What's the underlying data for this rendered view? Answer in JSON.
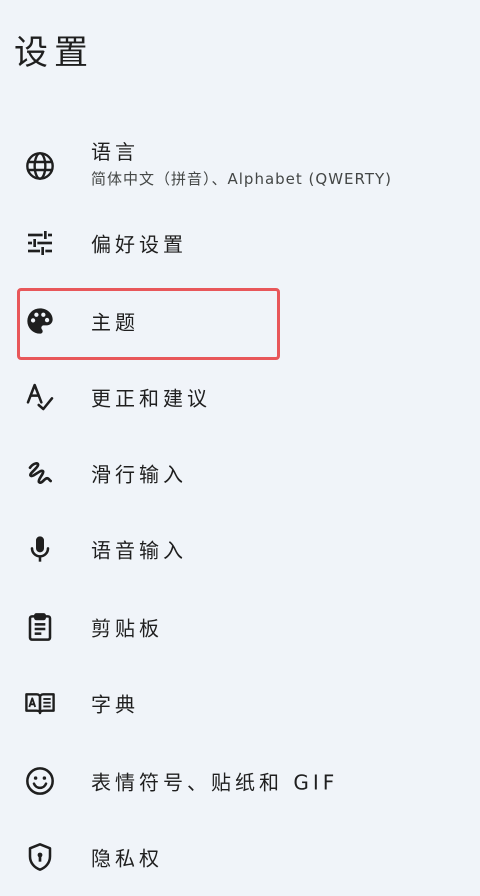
{
  "page": {
    "title": "设置"
  },
  "items": [
    {
      "id": "language",
      "label": "语言",
      "sublabel": "简体中文（拼音）、Alphabet (QWERTY)",
      "icon": "globe-icon"
    },
    {
      "id": "preferences",
      "label": "偏好设置",
      "icon": "tune-icon"
    },
    {
      "id": "theme",
      "label": "主题",
      "icon": "palette-icon"
    },
    {
      "id": "correction",
      "label": "更正和建议",
      "icon": "spellcheck-icon"
    },
    {
      "id": "glide",
      "label": "滑行输入",
      "icon": "gesture-icon"
    },
    {
      "id": "voice",
      "label": "语音输入",
      "icon": "mic-icon"
    },
    {
      "id": "clipboard",
      "label": "剪贴板",
      "icon": "clipboard-icon"
    },
    {
      "id": "dictionary",
      "label": "字典",
      "icon": "dictionary-icon"
    },
    {
      "id": "emoji",
      "label": "表情符号、贴纸和 GIF",
      "icon": "emoji-icon"
    },
    {
      "id": "privacy",
      "label": "隐私权",
      "icon": "shield-icon"
    }
  ],
  "colors": {
    "background": "#f0f4f9",
    "text": "#1f1f1f",
    "highlight": "#e8575a"
  }
}
